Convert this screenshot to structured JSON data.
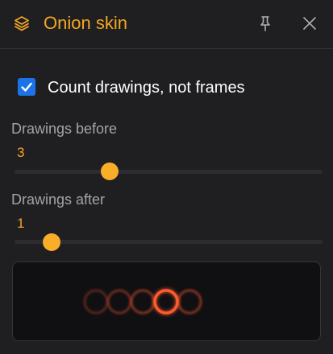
{
  "header": {
    "title": "Onion skin",
    "layers_icon": "layers-icon",
    "pin_icon": "pin-icon",
    "close_icon": "close-icon"
  },
  "options": {
    "count_drawings": {
      "label": "Count drawings, not frames",
      "checked": true
    }
  },
  "drawings_before": {
    "label": "Drawings before",
    "value": "3",
    "slider_fraction": 0.31
  },
  "drawings_after": {
    "label": "Drawings after",
    "value": "1",
    "slider_fraction": 0.12
  },
  "preview": {
    "previous_count": 3,
    "next_count": 1
  },
  "colors": {
    "accent": "#f5a623",
    "checkbox": "#1a73e8",
    "current_frame": "#ff5a2e",
    "onion_frames": "#c94a2a"
  }
}
